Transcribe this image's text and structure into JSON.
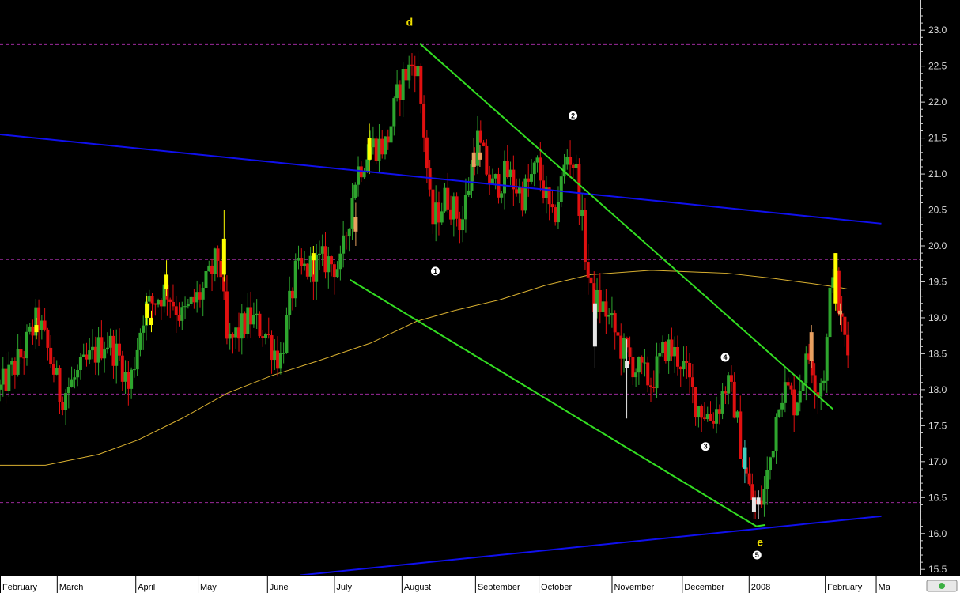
{
  "chart_data": {
    "type": "candlestick",
    "y_axis": {
      "ylim": [
        15.42,
        23.42
      ],
      "ticks": [
        "23.0",
        "22.5",
        "22.0",
        "21.5",
        "21.0",
        "20.5",
        "20.0",
        "19.5",
        "19.0",
        "18.5",
        "18.0",
        "17.5",
        "17.0",
        "16.5",
        "16.0",
        "15.5"
      ],
      "tick_values": [
        23.0,
        22.5,
        22.0,
        21.5,
        21.0,
        20.5,
        20.0,
        19.5,
        19.0,
        18.5,
        18.0,
        17.5,
        17.0,
        16.5,
        16.0,
        15.5
      ],
      "side": "right"
    },
    "x_axis": {
      "labels": [
        "February",
        "March",
        "April",
        "May",
        "June",
        "July",
        "August",
        "September",
        "October",
        "November",
        "December",
        "2008",
        "February",
        "Ma"
      ],
      "label_t": [
        0,
        0.0617,
        0.1471,
        0.2148,
        0.2902,
        0.3629,
        0.4363,
        0.5162,
        0.5851,
        0.6645,
        0.7408,
        0.8134,
        0.8962,
        0.9515
      ]
    },
    "colors": {
      "background": "#000000",
      "axis_panel": "#ffffff",
      "up": "#2ea52e",
      "down": "#e01010",
      "neutral": "#e6e6e6",
      "trend_blue": "#1010ee",
      "trend_green": "#33dd22",
      "ma_line": "#d9b030",
      "hline": "#9a2a9a",
      "highlight_yellow": "#ffff00",
      "highlight_orange": "#e8a060",
      "highlight_cyan": "#40d0c0",
      "annotation": "#ffea00"
    },
    "horizontal_lines": [
      22.8,
      19.81,
      17.94,
      16.43
    ],
    "trendlines": [
      {
        "name": "blue-upper",
        "color": "blue",
        "points": [
          {
            "t": 0.0,
            "v": 21.55
          },
          {
            "t": 0.9575,
            "v": 20.31
          }
        ]
      },
      {
        "name": "blue-lower",
        "color": "blue",
        "points": [
          {
            "t": 0.3263,
            "v": 15.42
          },
          {
            "t": 0.9575,
            "v": 16.24
          }
        ]
      },
      {
        "name": "green-upper",
        "color": "green",
        "points": [
          {
            "t": 0.4565,
            "v": 22.81
          },
          {
            "t": 0.9048,
            "v": 17.73
          }
        ]
      },
      {
        "name": "green-lower",
        "color": "green",
        "points": [
          {
            "t": 0.3801,
            "v": 19.53
          },
          {
            "t": 0.8217,
            "v": 16.1
          }
        ]
      },
      {
        "name": "green-bottom",
        "color": "green",
        "points": [
          {
            "t": 0.8217,
            "v": 16.1
          },
          {
            "t": 0.8316,
            "v": 16.12
          }
        ]
      }
    ],
    "moving_average": [
      {
        "t": 0.0,
        "v": 16.95
      },
      {
        "t": 0.0493,
        "v": 16.95
      },
      {
        "t": 0.1069,
        "v": 17.1
      },
      {
        "t": 0.1497,
        "v": 17.3
      },
      {
        "t": 0.1974,
        "v": 17.6
      },
      {
        "t": 0.2467,
        "v": 17.95
      },
      {
        "t": 0.2961,
        "v": 18.2
      },
      {
        "t": 0.3454,
        "v": 18.4
      },
      {
        "t": 0.403,
        "v": 18.65
      },
      {
        "t": 0.4523,
        "v": 18.95
      },
      {
        "t": 0.4934,
        "v": 19.1
      },
      {
        "t": 0.5428,
        "v": 19.25
      },
      {
        "t": 0.5921,
        "v": 19.45
      },
      {
        "t": 0.6414,
        "v": 19.6
      },
      {
        "t": 0.7072,
        "v": 19.66
      },
      {
        "t": 0.7895,
        "v": 19.62
      },
      {
        "t": 0.8388,
        "v": 19.55
      },
      {
        "t": 0.8799,
        "v": 19.48
      },
      {
        "t": 0.9128,
        "v": 19.42
      },
      {
        "t": 0.9211,
        "v": 19.4
      }
    ],
    "price_path": [
      {
        "t": 0.0,
        "v": 18.0
      },
      {
        "t": 0.0247,
        "v": 18.5
      },
      {
        "t": 0.0411,
        "v": 19.0
      },
      {
        "t": 0.0576,
        "v": 18.3
      },
      {
        "t": 0.0658,
        "v": 17.9
      },
      {
        "t": 0.0905,
        "v": 18.3
      },
      {
        "t": 0.1151,
        "v": 18.7
      },
      {
        "t": 0.1316,
        "v": 18.4
      },
      {
        "t": 0.1398,
        "v": 18.0
      },
      {
        "t": 0.1562,
        "v": 19.1
      },
      {
        "t": 0.1809,
        "v": 19.4
      },
      {
        "t": 0.1974,
        "v": 19.0
      },
      {
        "t": 0.222,
        "v": 19.4
      },
      {
        "t": 0.2385,
        "v": 19.9
      },
      {
        "t": 0.2467,
        "v": 18.6
      },
      {
        "t": 0.2714,
        "v": 19.0
      },
      {
        "t": 0.2878,
        "v": 18.8
      },
      {
        "t": 0.3043,
        "v": 18.4
      },
      {
        "t": 0.3207,
        "v": 19.6
      },
      {
        "t": 0.3372,
        "v": 19.7
      },
      {
        "t": 0.3536,
        "v": 19.8
      },
      {
        "t": 0.3701,
        "v": 19.7
      },
      {
        "t": 0.3865,
        "v": 21.0
      },
      {
        "t": 0.403,
        "v": 21.4
      },
      {
        "t": 0.4194,
        "v": 21.4
      },
      {
        "t": 0.4359,
        "v": 22.3
      },
      {
        "t": 0.4523,
        "v": 22.6
      },
      {
        "t": 0.4605,
        "v": 21.6
      },
      {
        "t": 0.4688,
        "v": 20.3
      },
      {
        "t": 0.4852,
        "v": 20.7
      },
      {
        "t": 0.5016,
        "v": 20.3
      },
      {
        "t": 0.5181,
        "v": 21.5
      },
      {
        "t": 0.5345,
        "v": 20.8
      },
      {
        "t": 0.551,
        "v": 21.0
      },
      {
        "t": 0.5674,
        "v": 20.7
      },
      {
        "t": 0.5839,
        "v": 21.1
      },
      {
        "t": 0.6003,
        "v": 20.3
      },
      {
        "t": 0.6168,
        "v": 21.3
      },
      {
        "t": 0.625,
        "v": 21.1
      },
      {
        "t": 0.6332,
        "v": 20.2
      },
      {
        "t": 0.6414,
        "v": 19.3
      },
      {
        "t": 0.6579,
        "v": 19.1
      },
      {
        "t": 0.6743,
        "v": 18.6
      },
      {
        "t": 0.6908,
        "v": 18.3
      },
      {
        "t": 0.7072,
        "v": 18.1
      },
      {
        "t": 0.7237,
        "v": 18.6
      },
      {
        "t": 0.7401,
        "v": 18.4
      },
      {
        "t": 0.7566,
        "v": 17.8
      },
      {
        "t": 0.773,
        "v": 17.6
      },
      {
        "t": 0.7812,
        "v": 17.8
      },
      {
        "t": 0.7895,
        "v": 18.1
      },
      {
        "t": 0.7977,
        "v": 17.8
      },
      {
        "t": 0.8059,
        "v": 17.1
      },
      {
        "t": 0.8141,
        "v": 16.6
      },
      {
        "t": 0.8224,
        "v": 16.3
      },
      {
        "t": 0.8306,
        "v": 16.6
      },
      {
        "t": 0.8388,
        "v": 17.2
      },
      {
        "t": 0.847,
        "v": 18.0
      },
      {
        "t": 0.8553,
        "v": 18.0
      },
      {
        "t": 0.8635,
        "v": 17.8
      },
      {
        "t": 0.8717,
        "v": 18.2
      },
      {
        "t": 0.8799,
        "v": 18.5
      },
      {
        "t": 0.8882,
        "v": 18.0
      },
      {
        "t": 0.8964,
        "v": 18.3
      },
      {
        "t": 0.9046,
        "v": 19.8
      },
      {
        "t": 0.9128,
        "v": 19.0
      },
      {
        "t": 0.9211,
        "v": 18.5
      }
    ],
    "highlights": [
      {
        "t": 0.0395,
        "o": 18.9,
        "c": 18.8,
        "h": 19.0,
        "l": 18.7,
        "color": "yellow"
      },
      {
        "t": 0.1595,
        "o": 19.0,
        "c": 19.2,
        "h": 19.3,
        "l": 18.9,
        "color": "yellow"
      },
      {
        "t": 0.1645,
        "o": 18.9,
        "c": 19.0,
        "h": 19.1,
        "l": 18.8,
        "color": "yellow"
      },
      {
        "t": 0.1809,
        "o": 19.6,
        "c": 19.4,
        "h": 19.8,
        "l": 19.3,
        "color": "yellow"
      },
      {
        "t": 0.2434,
        "o": 19.6,
        "c": 20.1,
        "h": 20.5,
        "l": 19.5,
        "color": "yellow"
      },
      {
        "t": 0.3405,
        "o": 19.8,
        "c": 19.9,
        "h": 20.0,
        "l": 19.6,
        "color": "yellow"
      },
      {
        "t": 0.3865,
        "o": 20.2,
        "c": 20.4,
        "h": 20.6,
        "l": 20.0,
        "color": "orange"
      },
      {
        "t": 0.4013,
        "o": 21.2,
        "c": 21.5,
        "h": 21.7,
        "l": 21.0,
        "color": "yellow"
      },
      {
        "t": 0.5148,
        "o": 21.1,
        "c": 21.3,
        "h": 21.5,
        "l": 20.9,
        "color": "orange"
      },
      {
        "t": 0.5214,
        "o": 21.2,
        "c": 21.3,
        "h": 21.4,
        "l": 21.1,
        "color": "orange"
      },
      {
        "t": 0.6464,
        "o": 18.6,
        "c": 19.2,
        "h": 19.4,
        "l": 18.3,
        "color": "neutral"
      },
      {
        "t": 0.6809,
        "o": 18.4,
        "c": 18.3,
        "h": 18.7,
        "l": 17.6,
        "color": "neutral"
      },
      {
        "t": 0.8092,
        "o": 16.9,
        "c": 17.2,
        "h": 17.3,
        "l": 16.7,
        "color": "cyan"
      },
      {
        "t": 0.8191,
        "o": 16.5,
        "c": 16.3,
        "h": 16.6,
        "l": 16.2,
        "color": "neutral"
      },
      {
        "t": 0.824,
        "o": 16.4,
        "c": 16.5,
        "h": 16.6,
        "l": 16.2,
        "color": "neutral"
      },
      {
        "t": 0.8816,
        "o": 18.4,
        "c": 18.8,
        "h": 18.9,
        "l": 18.3,
        "color": "orange"
      },
      {
        "t": 0.9079,
        "o": 19.2,
        "c": 19.9,
        "h": 19.9,
        "l": 19.1,
        "color": "yellow"
      },
      {
        "t": 0.9128,
        "o": 19.1,
        "c": 19.05,
        "h": 19.2,
        "l": 18.9,
        "color": "orange"
      }
    ],
    "annotations": [
      {
        "text": "d",
        "kind": "letter",
        "t": 0.4449,
        "v": 23.12
      },
      {
        "text": "e",
        "kind": "letter",
        "t": 0.8257,
        "v": 15.88
      },
      {
        "text": "1",
        "kind": "circle",
        "t": 0.4729,
        "v": 19.65
      },
      {
        "text": "2",
        "kind": "circle",
        "t": 0.6225,
        "v": 21.81
      },
      {
        "text": "3",
        "kind": "circle",
        "t": 0.7664,
        "v": 17.21
      },
      {
        "text": "4",
        "kind": "circle",
        "t": 0.7878,
        "v": 18.45
      },
      {
        "text": "5",
        "kind": "circle",
        "t": 0.8224,
        "v": 15.7
      }
    ]
  }
}
